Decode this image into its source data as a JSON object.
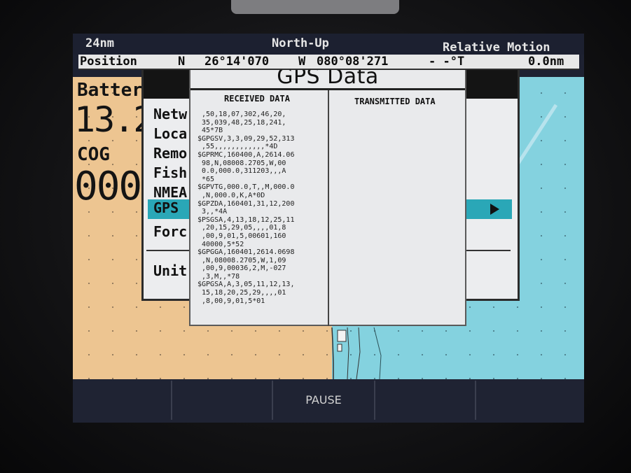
{
  "header": {
    "range": "24nm",
    "orientation": "North-Up",
    "motion_mode": "Relative Motion",
    "position_label": "Position",
    "lat_hemi": "N",
    "lat": "26°14'070",
    "lon_hemi": "W",
    "lon": "080°08'271",
    "heading": "- -°T",
    "distance": "0.0nm"
  },
  "databox": {
    "battery_label": "Batter",
    "battery_value": "13.2",
    "cog_label": "COG",
    "cog_value": "000"
  },
  "menu": {
    "items": [
      "Netw",
      "Loca",
      "Remo",
      "Fish",
      "NMEA",
      "GPS",
      "Forc",
      "Unit"
    ],
    "selected": "GPS"
  },
  "gps_window": {
    "title": "GPS Data",
    "received_header": "RECEIVED DATA",
    "transmitted_header": "TRANSMITTED DATA",
    "received_lines": [
      " ,50,18,07,302,46,20,",
      " 35,039,48,25,18,241,",
      " 45*7B",
      "$GPGSV,3,3,09,29,52,313",
      " ,55,,,,,,,,,,,,*4D",
      "$GPRMC,160400,A,2614.06",
      " 98,N,08008.2705,W,00",
      " 0.0,000.0,311203,,,A",
      " *65",
      "$GPVTG,000.0,T,,M,000.0",
      " ,N,000.0,K,A*0D",
      "$GPZDA,160401,31,12,200",
      " 3,,*4A",
      "$PSGSA,4,13,18,12,25,11",
      " ,20,15,29,05,,,,01,8",
      " ,00,9,01,5,00601,160",
      " 40000,5*52",
      "$GPGGA,160401,2614.0698",
      " ,N,08008.2705,W,1,09",
      " ,00,9,00036,2,M,-027",
      " ,3,M,,*78",
      "$GPGSA,A,3,05,11,12,13,",
      " 15,18,20,25,29,,,,01",
      " ,8,00,9,01,5*01"
    ]
  },
  "softkeys": [
    "",
    "",
    "PAUSE",
    "",
    ""
  ],
  "colors": {
    "land": "#edc591",
    "sea": "#84d2df",
    "highlight": "#2aa7b7",
    "panel": "#e9eaec"
  }
}
